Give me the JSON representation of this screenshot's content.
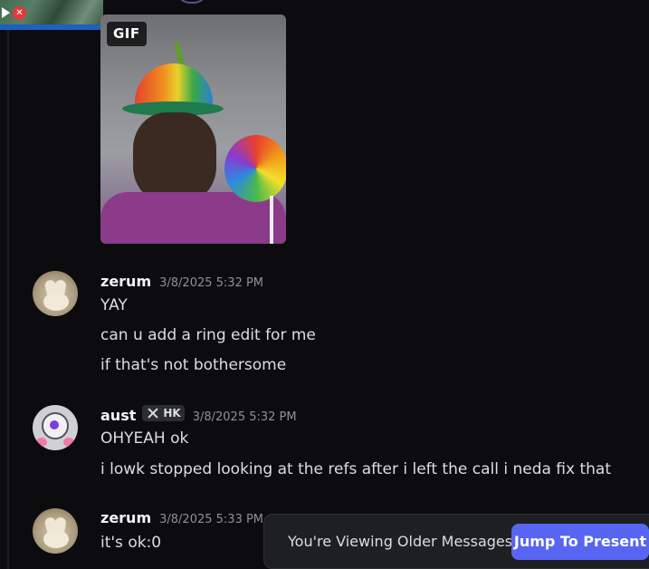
{
  "gif": {
    "badge": "GIF"
  },
  "messages": [
    {
      "username": "zerum",
      "timestamp": "3/8/2025 5:32 PM",
      "lines": [
        "YAY",
        "can u add a ring edit for me",
        "if that's not bothersome"
      ]
    },
    {
      "username": "aust",
      "tag": "HK",
      "timestamp": "3/8/2025 5:32 PM",
      "lines": [
        "OHYEAH ok",
        "i lowk stopped looking at the refs after i left the call i neda fix that"
      ]
    },
    {
      "username": "zerum",
      "timestamp": "3/8/2025 5:33 PM",
      "lines": [
        "it's ok:0"
      ]
    }
  ],
  "older_bar": {
    "text": "You're Viewing Older Messages",
    "button": "Jump To Present"
  },
  "colors": {
    "accent": "#5865f2",
    "background": "#0c0c0f"
  }
}
